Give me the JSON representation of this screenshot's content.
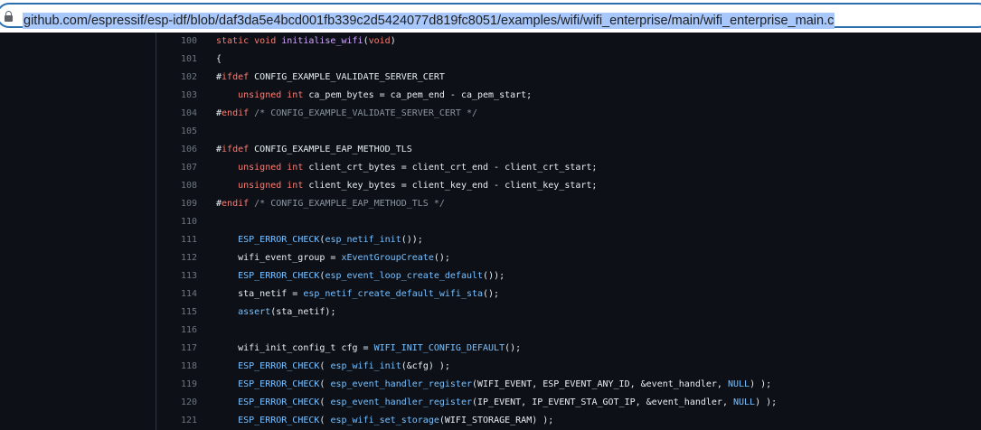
{
  "address_bar": {
    "url": "github.com/espressif/esp-idf/blob/daf3da5e4bcd001fb339c2d5424077d819fc8051/examples/wifi/wifi_enterprise/main/wifi_enterprise_main.c",
    "icon": "lock-icon"
  },
  "code": {
    "lines": [
      {
        "n": "100",
        "t": [
          [
            "k",
            "static void "
          ],
          [
            "f",
            "initialise_wifi"
          ],
          [
            "p",
            "("
          ],
          [
            "k",
            "void"
          ],
          [
            "p",
            ")"
          ]
        ]
      },
      {
        "n": "101",
        "t": [
          [
            "p",
            "{"
          ]
        ]
      },
      {
        "n": "102",
        "t": [
          [
            "p",
            "#"
          ],
          [
            "k",
            "ifdef"
          ],
          [
            "p",
            " CONFIG_EXAMPLE_VALIDATE_SERVER_CERT"
          ]
        ]
      },
      {
        "n": "103",
        "t": [
          [
            "p",
            "    "
          ],
          [
            "k",
            "unsigned int"
          ],
          [
            "p",
            " ca_pem_bytes = ca_pem_end - ca_pem_start;"
          ]
        ]
      },
      {
        "n": "104",
        "t": [
          [
            "p",
            "#"
          ],
          [
            "k",
            "endif"
          ],
          [
            "m",
            " /* CONFIG_EXAMPLE_VALIDATE_SERVER_CERT */"
          ]
        ]
      },
      {
        "n": "105",
        "t": []
      },
      {
        "n": "106",
        "t": [
          [
            "p",
            "#"
          ],
          [
            "k",
            "ifdef"
          ],
          [
            "p",
            " CONFIG_EXAMPLE_EAP_METHOD_TLS"
          ]
        ]
      },
      {
        "n": "107",
        "t": [
          [
            "p",
            "    "
          ],
          [
            "k",
            "unsigned int"
          ],
          [
            "p",
            " client_crt_bytes = client_crt_end - client_crt_start;"
          ]
        ]
      },
      {
        "n": "108",
        "t": [
          [
            "p",
            "    "
          ],
          [
            "k",
            "unsigned int"
          ],
          [
            "p",
            " client_key_bytes = client_key_end - client_key_start;"
          ]
        ]
      },
      {
        "n": "109",
        "t": [
          [
            "p",
            "#"
          ],
          [
            "k",
            "endif"
          ],
          [
            "m",
            " /* CONFIG_EXAMPLE_EAP_METHOD_TLS */"
          ]
        ]
      },
      {
        "n": "110",
        "t": []
      },
      {
        "n": "111",
        "t": [
          [
            "p",
            "    "
          ],
          [
            "c",
            "ESP_ERROR_CHECK"
          ],
          [
            "p",
            "("
          ],
          [
            "c",
            "esp_netif_init"
          ],
          [
            "p",
            "());"
          ]
        ]
      },
      {
        "n": "112",
        "t": [
          [
            "p",
            "    wifi_event_group = "
          ],
          [
            "c",
            "xEventGroupCreate"
          ],
          [
            "p",
            "();"
          ]
        ]
      },
      {
        "n": "113",
        "t": [
          [
            "p",
            "    "
          ],
          [
            "c",
            "ESP_ERROR_CHECK"
          ],
          [
            "p",
            "("
          ],
          [
            "c",
            "esp_event_loop_create_default"
          ],
          [
            "p",
            "());"
          ]
        ]
      },
      {
        "n": "114",
        "t": [
          [
            "p",
            "    sta_netif = "
          ],
          [
            "c",
            "esp_netif_create_default_wifi_sta"
          ],
          [
            "p",
            "();"
          ]
        ]
      },
      {
        "n": "115",
        "t": [
          [
            "p",
            "    "
          ],
          [
            "c",
            "assert"
          ],
          [
            "p",
            "(sta_netif);"
          ]
        ]
      },
      {
        "n": "116",
        "t": []
      },
      {
        "n": "117",
        "t": [
          [
            "p",
            "    wifi_init_config_t cfg = "
          ],
          [
            "c",
            "WIFI_INIT_CONFIG_DEFAULT"
          ],
          [
            "p",
            "();"
          ]
        ]
      },
      {
        "n": "118",
        "t": [
          [
            "p",
            "    "
          ],
          [
            "c",
            "ESP_ERROR_CHECK"
          ],
          [
            "p",
            "( "
          ],
          [
            "c",
            "esp_wifi_init"
          ],
          [
            "p",
            "(&cfg) );"
          ]
        ]
      },
      {
        "n": "119",
        "t": [
          [
            "p",
            "    "
          ],
          [
            "c",
            "ESP_ERROR_CHECK"
          ],
          [
            "p",
            "( "
          ],
          [
            "c",
            "esp_event_handler_register"
          ],
          [
            "p",
            "(WIFI_EVENT, ESP_EVENT_ANY_ID, &event_handler, "
          ],
          [
            "c",
            "NULL"
          ],
          [
            "p",
            ") );"
          ]
        ]
      },
      {
        "n": "120",
        "t": [
          [
            "p",
            "    "
          ],
          [
            "c",
            "ESP_ERROR_CHECK"
          ],
          [
            "p",
            "( "
          ],
          [
            "c",
            "esp_event_handler_register"
          ],
          [
            "p",
            "(IP_EVENT, IP_EVENT_STA_GOT_IP, &event_handler, "
          ],
          [
            "c",
            "NULL"
          ],
          [
            "p",
            ") );"
          ]
        ]
      },
      {
        "n": "121",
        "t": [
          [
            "p",
            "    "
          ],
          [
            "c",
            "ESP_ERROR_CHECK"
          ],
          [
            "p",
            "( "
          ],
          [
            "c",
            "esp_wifi_set_storage"
          ],
          [
            "p",
            "(WIFI_STORAGE_RAM) );"
          ]
        ]
      }
    ]
  }
}
